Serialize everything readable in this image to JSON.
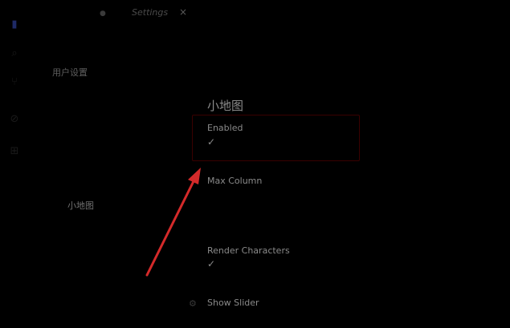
{
  "activity_bar": {
    "icons": [
      "files-icon",
      "search-icon",
      "source-control-icon",
      "debug-icon",
      "extensions-icon"
    ]
  },
  "tabs": [
    {
      "label": "Settings"
    }
  ],
  "toc": {
    "header": "用户设置",
    "selected": "小地图"
  },
  "section": {
    "title": "小地图"
  },
  "settings": [
    {
      "title": "Enabled"
    },
    {
      "title": "Max Column"
    },
    {
      "title": "Render Characters"
    },
    {
      "title": "Show Slider"
    }
  ],
  "colors": {
    "background": "#000000",
    "highlight_border": "#3a0000",
    "arrow": "#d42a2a"
  }
}
